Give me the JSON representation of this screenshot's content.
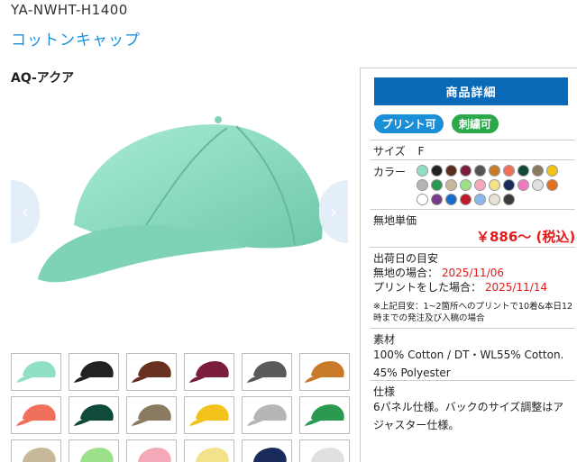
{
  "product": {
    "sku": "YA-NWHT-H1400",
    "name": "コットンキャップ",
    "color_name": "AQ-アクア"
  },
  "panel": {
    "detail_button": "商品詳細",
    "badges": [
      "プリント可",
      "刺繍可"
    ],
    "size_label": "サイズ",
    "size_value": "F",
    "color_label": "カラー",
    "swatch_colors": [
      "#8fe0c4",
      "#222222",
      "#5a2e1e",
      "#7a1e3c",
      "#555555",
      "#c97a28",
      "#f0705c",
      "#0f4a3a",
      "#8a7a60",
      "#f2c21a",
      "#b5b5b5",
      "#2a9a50",
      "#c8b89a",
      "#9ce08a",
      "#f4a8b8",
      "#f3e28a",
      "#1a2a5a",
      "#f07ac0",
      "#e0e0e0",
      "#e07020",
      "#ffffff",
      "#7a3a8a",
      "#1a6ac8",
      "#c01a2a",
      "#8ab8e8",
      "#e8e0d0",
      "#3a3a3a"
    ],
    "unit_price_label": "無地単価",
    "unit_price": "￥886～ (税込)",
    "ship_title": "出荷日の目安",
    "ship_plain_label": "無地の場合：",
    "ship_plain_date": "2025/11/06",
    "ship_print_label": "プリントをした場合：",
    "ship_print_date": "2025/11/14",
    "ship_note": "※上記目安：1~2箇所へのプリントで10着&本日12時までの発注及び入稿の場合",
    "material_label": "素材",
    "material_value": "100% Cotton / DT・WL55% Cotton. 45% Polyester",
    "spec_label": "仕様",
    "spec_value": "6パネル仕様。バックのサイズ調整はアジャスター仕様。"
  },
  "thumbnails": {
    "colors": [
      "#8fe0c4",
      "#222222",
      "#6a3020",
      "#7a1e3c",
      "#5a5a5a",
      "#c97a28",
      "#f0705c",
      "#0f4a3a",
      "#8a7a60",
      "#f2c21a",
      "#b5b5b5",
      "#2a9a50",
      "#c8b89a",
      "#9ce08a",
      "#f4a8b8",
      "#f3e28a",
      "#1a2a5a",
      "#e0e0e0"
    ]
  },
  "colors": {
    "accent": "#1a8fd8",
    "button": "#0a6ab8",
    "badge_embroidery": "#2aa84a",
    "price": "#e01b1b"
  },
  "icons": [
    "chevron-left-icon",
    "chevron-right-icon"
  ]
}
